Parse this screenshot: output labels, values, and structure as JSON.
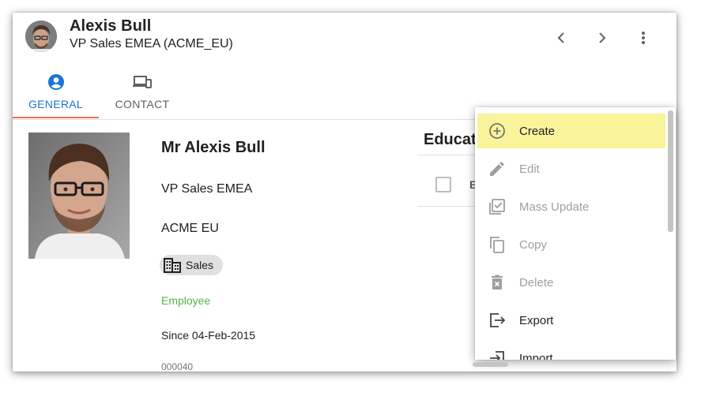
{
  "header": {
    "name": "Alexis Bull",
    "subtitle": "VP Sales EMEA (ACME_EU)",
    "prev_icon": "chevron-left-icon",
    "next_icon": "chevron-right-icon",
    "more_icon": "more-vert-icon"
  },
  "tabs": [
    {
      "label": "GENERAL",
      "icon": "account-circle-icon",
      "active": true,
      "color": "#1976d2"
    },
    {
      "label": "CONTACT",
      "icon": "devices-icon",
      "active": false,
      "color": "#616161"
    }
  ],
  "profile": {
    "name": "Mr Alexis Bull",
    "title": "VP Sales EMEA",
    "company": "ACME EU",
    "department": "Sales",
    "status": "Employee",
    "since": "Since 04-Feb-2015",
    "id": "000040"
  },
  "education": {
    "title": "Educati",
    "column_initial": "E"
  },
  "menu": {
    "items": [
      {
        "label": "Create",
        "icon": "add-circle-outline-icon",
        "highlighted": true,
        "enabled": true
      },
      {
        "label": "Edit",
        "icon": "pencil-icon",
        "enabled": false
      },
      {
        "label": "Mass Update",
        "icon": "mass-update-icon",
        "enabled": false
      },
      {
        "label": "Copy",
        "icon": "copy-icon",
        "enabled": false
      },
      {
        "label": "Delete",
        "icon": "trash-icon",
        "enabled": false
      },
      {
        "label": "Export",
        "icon": "export-icon",
        "enabled": true
      },
      {
        "label": "Import",
        "icon": "import-icon",
        "enabled": true
      }
    ]
  },
  "colors": {
    "accent": "#1976d2",
    "tab_indicator": "#e1744e",
    "status_green": "#5aaf4e",
    "menu_highlight": "#f9f39a"
  }
}
